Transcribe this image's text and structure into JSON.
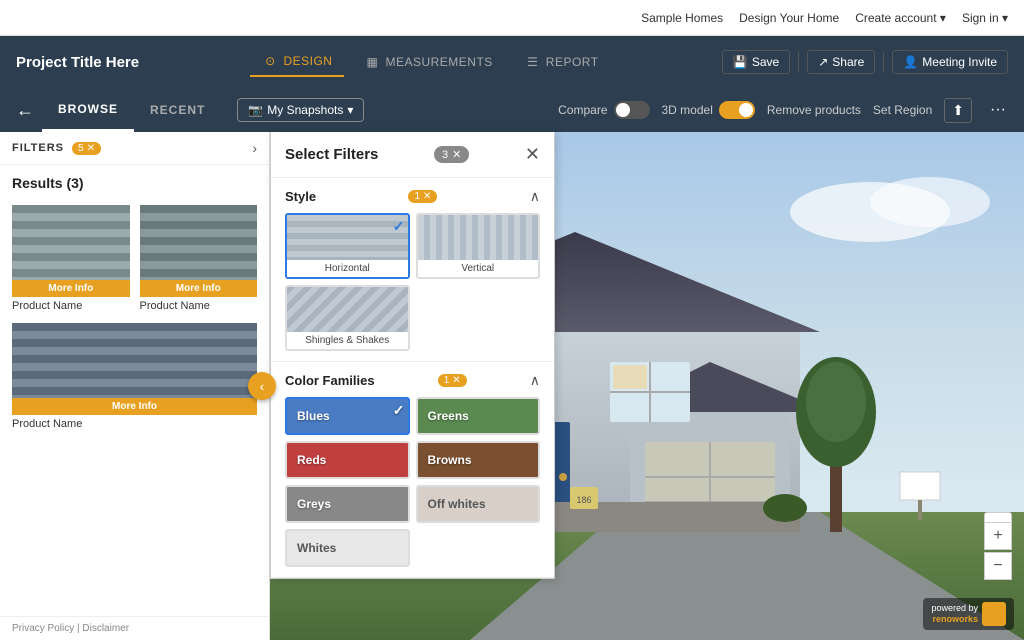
{
  "accountBar": {
    "sampleHomes": "Sample Homes",
    "designYourHome": "Design Your Home",
    "createAccount": "Create account ▾",
    "signIn": "Sign in ▾"
  },
  "topBar": {
    "projectTitle": "Project Title Here",
    "nav": [
      {
        "label": "DESIGN",
        "active": true,
        "icon": "⊙"
      },
      {
        "label": "MEASUREMENTS",
        "active": false,
        "icon": "▦"
      },
      {
        "label": "REPORT",
        "active": false,
        "icon": "☰"
      }
    ],
    "save": "Save",
    "share": "Share",
    "meetingInvite": "Meeting Invite"
  },
  "secondBar": {
    "browse": "BROWSE",
    "recent": "RECENT",
    "mySnapshots": "My Snapshots",
    "compare": "Compare",
    "model3d": "3D model",
    "removeProducts": "Remove products",
    "setRegion": "Set Region"
  },
  "filtersPanel": {
    "title": "Select Filters",
    "totalBadge": "3",
    "sections": {
      "style": {
        "title": "Style",
        "badge": "1",
        "items": [
          {
            "label": "Horizontal",
            "selected": true
          },
          {
            "label": "Vertical",
            "selected": false
          },
          {
            "label": "Shingles & Shakes",
            "selected": false
          }
        ]
      },
      "colorFamilies": {
        "title": "Color Families",
        "badge": "1",
        "items": [
          {
            "label": "Blues",
            "color": "blues",
            "selected": true
          },
          {
            "label": "Greens",
            "color": "greens",
            "selected": false
          },
          {
            "label": "Reds",
            "color": "reds",
            "selected": false
          },
          {
            "label": "Browns",
            "color": "browns",
            "selected": false
          },
          {
            "label": "Greys",
            "color": "greys",
            "selected": false
          },
          {
            "label": "Off whites",
            "color": "off-whites",
            "selected": false
          },
          {
            "label": "Whites",
            "color": "whites",
            "selected": false
          }
        ]
      }
    }
  },
  "leftPanel": {
    "filtersLabel": "FILTERS",
    "filtersBadge": "5",
    "resultsHeader": "Results (3)",
    "products": [
      {
        "name": "Product Name"
      },
      {
        "name": "Product Name"
      },
      {
        "name": "Product Name"
      }
    ],
    "moreInfoLabel": "More Info",
    "moreLabel": "More"
  },
  "footer": {
    "privacy": "Privacy Policy | Disclaimer"
  },
  "zoom": {
    "plus": "+",
    "minus": "−"
  },
  "logo": {
    "powered": "powered by",
    "brand": "renoworks"
  }
}
